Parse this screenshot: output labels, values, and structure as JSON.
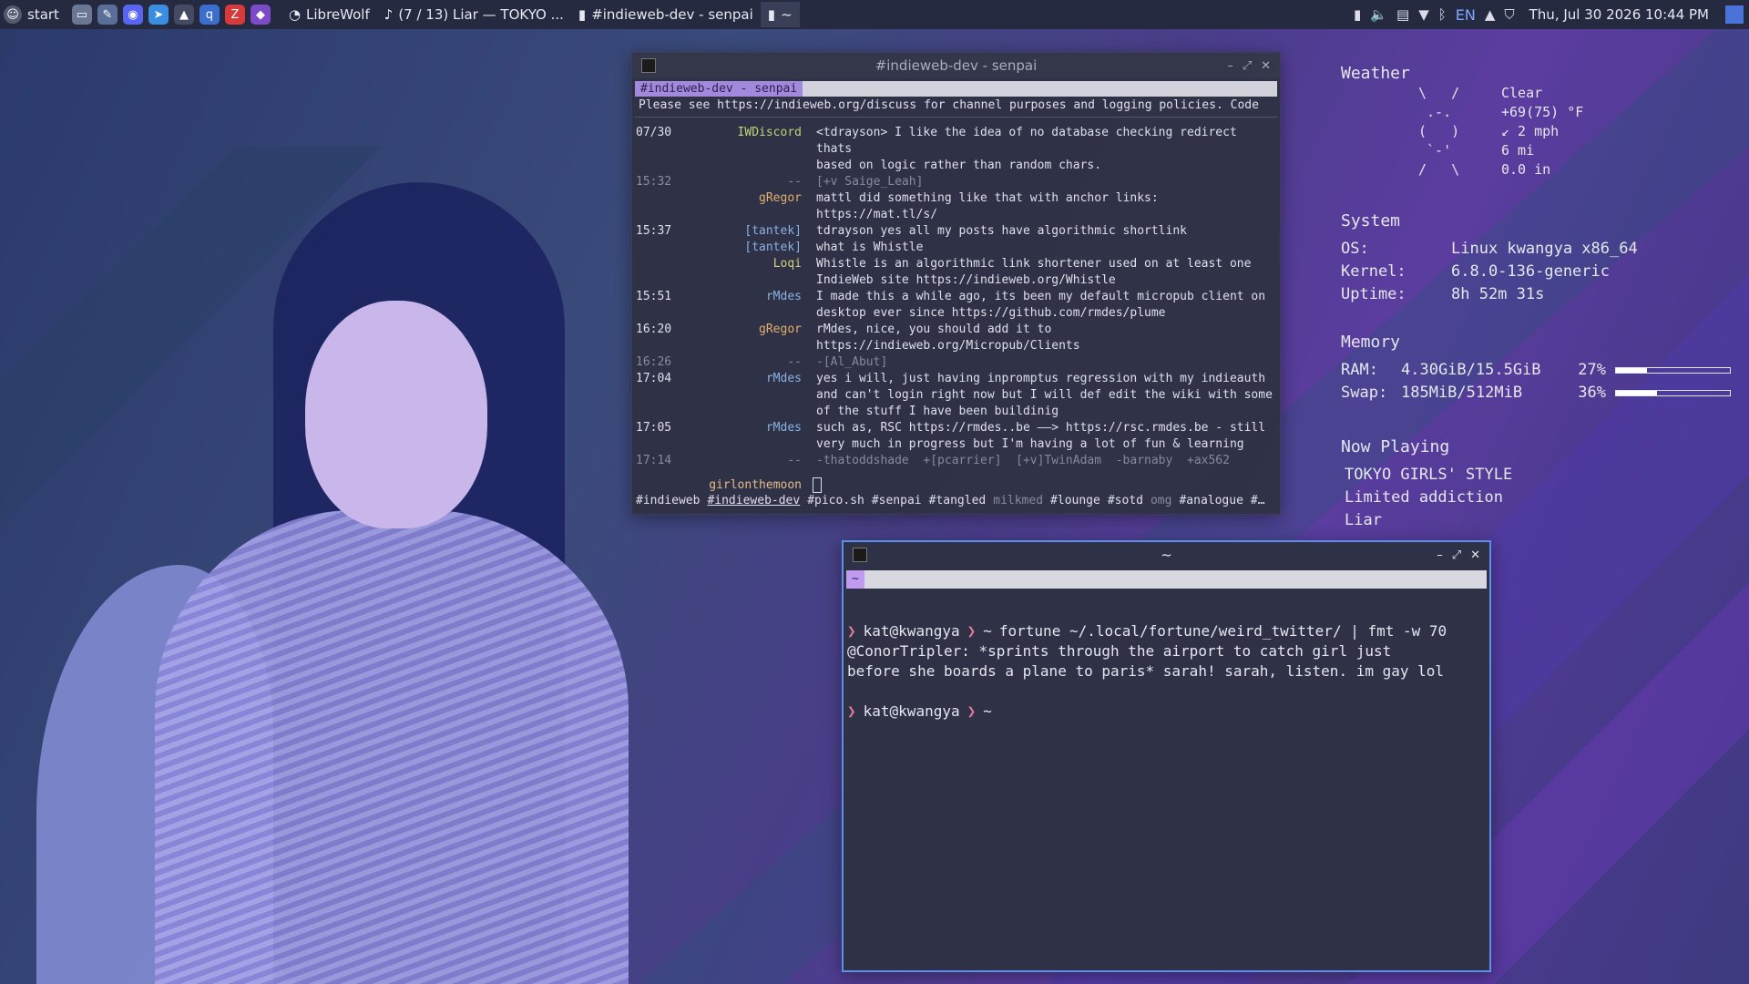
{
  "taskbar": {
    "start_label": "start",
    "launchers": [
      {
        "icon": "files-icon",
        "color": "#6b7894"
      },
      {
        "icon": "text-editor-icon",
        "color": "#5a6e9a"
      },
      {
        "icon": "discord-icon",
        "color": "#5865f2"
      },
      {
        "icon": "telegram-icon",
        "color": "#3a8de0"
      },
      {
        "icon": "arch-icon",
        "color": "#444a62"
      },
      {
        "icon": "qbittorrent-icon",
        "color": "#3a6fd0"
      },
      {
        "icon": "filezilla-icon",
        "color": "#d63a3a"
      },
      {
        "icon": "tor-icon",
        "color": "#7e4bc8"
      }
    ],
    "tasks": [
      {
        "icon": "librewolf-icon",
        "label": "LibreWolf",
        "active": false
      },
      {
        "icon": "music-player-icon",
        "label": "(7 / 13) Liar — TOKYO ...",
        "active": false
      },
      {
        "icon": "terminal-icon",
        "label": "#indieweb-dev - senpai",
        "active": false
      },
      {
        "icon": "terminal-icon",
        "label": "~",
        "active": true
      }
    ],
    "tray": [
      "battery-icon",
      "volume-icon",
      "clipboard-icon",
      "wifi-icon",
      "bluetooth-icon"
    ],
    "language": "EN",
    "clock": "Thu, Jul 30 2026 10:44 PM"
  },
  "conky": {
    "weather": {
      "title": "Weather",
      "art": "\\   /\n .-.\n(   )\n `-'\n/   \\",
      "condition": "Clear",
      "temp": "+69(75) °F",
      "wind": "↙ 2 mph",
      "visibility": "6 mi",
      "precip": "0.0 in"
    },
    "system": {
      "title": "System",
      "rows": [
        {
          "k": "OS:",
          "v": "Linux kwangya x86_64"
        },
        {
          "k": "Kernel:",
          "v": "6.8.0-136-generic"
        },
        {
          "k": "Uptime:",
          "v": "8h 52m 31s"
        }
      ]
    },
    "memory": {
      "title": "Memory",
      "ram": {
        "k": "RAM:",
        "v": "4.30GiB/15.5GiB",
        "pct": "27%",
        "fraction": 0.27
      },
      "swap": {
        "k": "Swap:",
        "v": "185MiB/512MiB",
        "pct": "36%",
        "fraction": 0.36
      }
    },
    "now_playing": {
      "title": "Now Playing",
      "artist": "TOKYO GIRLS' STYLE",
      "album": "Limited addiction",
      "track": "Liar"
    }
  },
  "irc": {
    "title": "#indieweb-dev - senpai",
    "tab": "#indieweb-dev - senpai",
    "topic": "Please see https://indieweb.org/discuss for channel purposes and logging policies. Code",
    "messages": [
      {
        "time": "07/30",
        "nick": "IWDiscord",
        "color": "#c9d870",
        "text": "<tdrayson> I like the idea of no database checking redirect thats\nbased on logic rather than random chars.",
        "dim": false
      },
      {
        "time": "15:32",
        "nick": "--",
        "color": "#8c8ea3",
        "text": "[+v Saige_Leah]",
        "dim": true
      },
      {
        "time": "",
        "nick": "gRegor",
        "color": "#e9b46a",
        "text": "mattl did something like that with anchor links:\nhttps://mat.tl/s/",
        "dim": false
      },
      {
        "time": "15:37",
        "nick": "[tantek]",
        "color": "#8ab6e8",
        "text": "tdrayson yes all my posts have algorithmic shortlink",
        "dim": false
      },
      {
        "time": "",
        "nick": "[tantek]",
        "color": "#8ab6e8",
        "text": "what is Whistle",
        "dim": false
      },
      {
        "time": "",
        "nick": "Loqi",
        "color": "#d8d87a",
        "text": "Whistle is an algorithmic link shortener used on at least one\nIndieWeb site https://indieweb.org/Whistle",
        "dim": false
      },
      {
        "time": "15:51",
        "nick": "rMdes",
        "color": "#8ab6e8",
        "text": "I made this a while ago, its been my default micropub client on\ndesktop ever since https://github.com/rmdes/plume",
        "dim": false
      },
      {
        "time": "16:20",
        "nick": "gRegor",
        "color": "#e9b46a",
        "text": "rMdes, nice, you should add it to\nhttps://indieweb.org/Micropub/Clients",
        "dim": false
      },
      {
        "time": "16:26",
        "nick": "--",
        "color": "#8c8ea3",
        "text": "-[Al_Abut]",
        "dim": true
      },
      {
        "time": "17:04",
        "nick": "rMdes",
        "color": "#8ab6e8",
        "text": "yes i will, just having inpromptus regression with my indieauth\nand can't login right now but I will def edit the wiki with some\nof the stuff I have been buildinig",
        "dim": false
      },
      {
        "time": "17:05",
        "nick": "rMdes",
        "color": "#8ab6e8",
        "text": "such as, RSC https://rmdes..be ——> https://rsc.rmdes.be - still\nvery much in progress but I'm having a lot of fun & learning",
        "dim": false
      },
      {
        "time": "17:14",
        "nick": "--",
        "color": "#8c8ea3",
        "text": "-thatoddshade  +[pcarrier]  [+v]TwinAdam  -barnaby  +ax562",
        "dim": true
      }
    ],
    "self_nick": "girlonthemoon",
    "channels": [
      {
        "name": "#indieweb",
        "state": "normal"
      },
      {
        "name": "#indieweb-dev",
        "state": "current"
      },
      {
        "name": "#pico.sh",
        "state": "normal"
      },
      {
        "name": "#senpai",
        "state": "normal"
      },
      {
        "name": "#tangled",
        "state": "normal"
      },
      {
        "name": "milkmed",
        "state": "dim"
      },
      {
        "name": "#lounge",
        "state": "normal"
      },
      {
        "name": "#sotd",
        "state": "normal"
      },
      {
        "name": "omg",
        "state": "dim"
      },
      {
        "name": "#analogue",
        "state": "normal"
      },
      {
        "name": "#…",
        "state": "normal"
      }
    ]
  },
  "terminal": {
    "title": "~",
    "tab": "~",
    "prompt_user": "kat@kwangya",
    "prompt_dir": "~",
    "command": "fortune ~/.local/fortune/weird_twitter/ | fmt -w 70",
    "output": [
      "@ConorTripler: *sprints through the airport to catch girl just",
      "before she boards a plane to paris* sarah! sarah, listen. im gay lol"
    ]
  }
}
